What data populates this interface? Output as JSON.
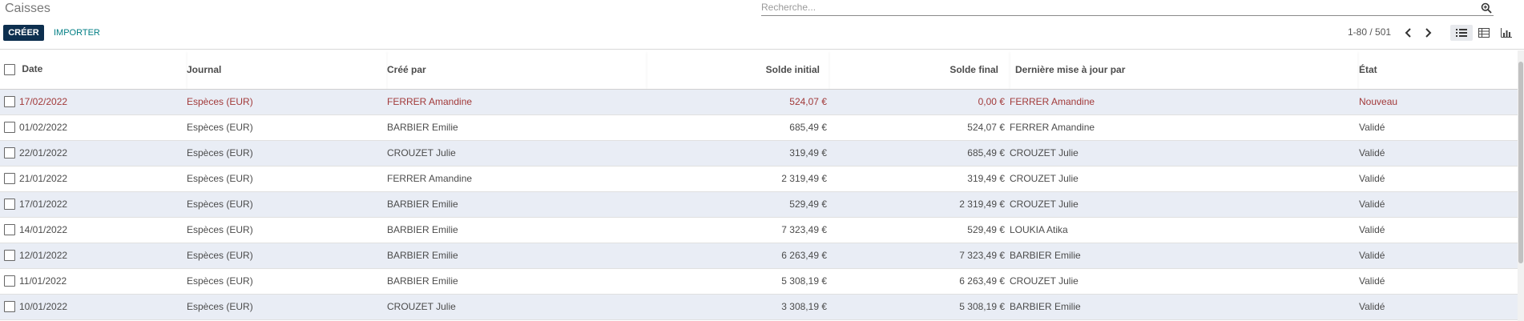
{
  "control_panel": {
    "title": "Caisses",
    "search_placeholder": "Recherche...",
    "create_label": "CRÉER",
    "import_label": "IMPORTER",
    "pager_value": "1-80 / 501",
    "active_view": "list"
  },
  "colors": {
    "primary": "#0d2f4f",
    "link": "#017e84",
    "draft_row_text": "#a23a3a",
    "striped_row": "#e9edf5"
  },
  "table": {
    "columns": [
      "Date",
      "Journal",
      "Créé par",
      "Solde initial",
      "Solde final",
      "Dernière mise à jour par",
      "État"
    ],
    "rows": [
      {
        "date": "17/02/2022",
        "journal": "Espèces (EUR)",
        "created_by": "FERRER Amandine",
        "initial": "524,07 €",
        "final": "0,00 €",
        "updated_by": "FERRER Amandine",
        "state": "Nouveau",
        "draft": true
      },
      {
        "date": "01/02/2022",
        "journal": "Espèces (EUR)",
        "created_by": "BARBIER Emilie",
        "initial": "685,49 €",
        "final": "524,07 €",
        "updated_by": "FERRER Amandine",
        "state": "Validé",
        "draft": false
      },
      {
        "date": "22/01/2022",
        "journal": "Espèces (EUR)",
        "created_by": "CROUZET Julie",
        "initial": "319,49 €",
        "final": "685,49 €",
        "updated_by": "CROUZET Julie",
        "state": "Validé",
        "draft": false
      },
      {
        "date": "21/01/2022",
        "journal": "Espèces (EUR)",
        "created_by": "FERRER Amandine",
        "initial": "2 319,49 €",
        "final": "319,49 €",
        "updated_by": "CROUZET Julie",
        "state": "Validé",
        "draft": false
      },
      {
        "date": "17/01/2022",
        "journal": "Espèces (EUR)",
        "created_by": "BARBIER Emilie",
        "initial": "529,49 €",
        "final": "2 319,49 €",
        "updated_by": "CROUZET Julie",
        "state": "Validé",
        "draft": false
      },
      {
        "date": "14/01/2022",
        "journal": "Espèces (EUR)",
        "created_by": "BARBIER Emilie",
        "initial": "7 323,49 €",
        "final": "529,49 €",
        "updated_by": "LOUKIA Atika",
        "state": "Validé",
        "draft": false
      },
      {
        "date": "12/01/2022",
        "journal": "Espèces (EUR)",
        "created_by": "BARBIER Emilie",
        "initial": "6 263,49 €",
        "final": "7 323,49 €",
        "updated_by": "BARBIER Emilie",
        "state": "Validé",
        "draft": false
      },
      {
        "date": "11/01/2022",
        "journal": "Espèces (EUR)",
        "created_by": "BARBIER Emilie",
        "initial": "5 308,19 €",
        "final": "6 263,49 €",
        "updated_by": "CROUZET Julie",
        "state": "Validé",
        "draft": false
      },
      {
        "date": "10/01/2022",
        "journal": "Espèces (EUR)",
        "created_by": "CROUZET Julie",
        "initial": "3 308,19 €",
        "final": "5 308,19 €",
        "updated_by": "BARBIER Emilie",
        "state": "Validé",
        "draft": false
      }
    ]
  }
}
